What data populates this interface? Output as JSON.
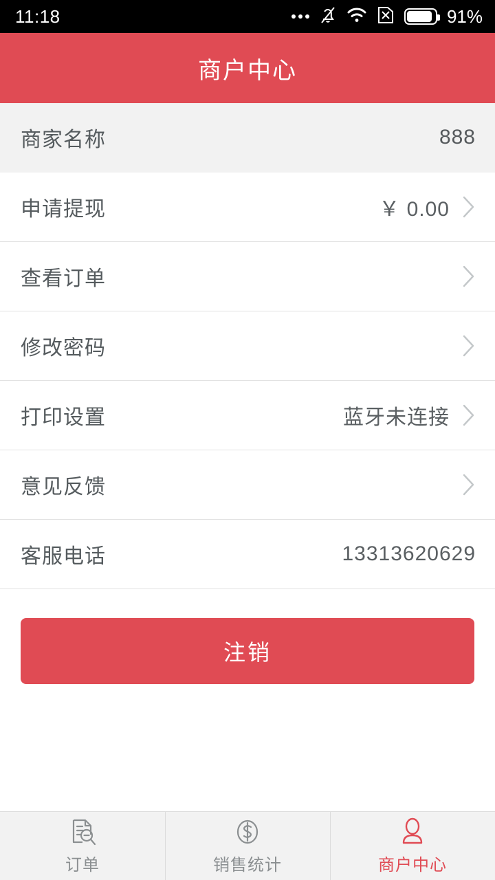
{
  "statusbar": {
    "time": "11:18",
    "battery_percent": "91%",
    "icons": [
      "more-dots-icon",
      "bell-muted-icon",
      "wifi-icon",
      "sim-disabled-icon",
      "battery-icon"
    ]
  },
  "header": {
    "title": "商户中心"
  },
  "list": {
    "rows": [
      {
        "label": "商家名称",
        "value": "888",
        "chevron": false,
        "shaded": true
      },
      {
        "label": "申请提现",
        "value": "￥ 0.00",
        "chevron": true,
        "shaded": false
      },
      {
        "label": "查看订单",
        "value": "",
        "chevron": true,
        "shaded": false
      },
      {
        "label": "修改密码",
        "value": "",
        "chevron": true,
        "shaded": false
      },
      {
        "label": "打印设置",
        "value": "蓝牙未连接",
        "chevron": true,
        "shaded": false
      },
      {
        "label": "意见反馈",
        "value": "",
        "chevron": true,
        "shaded": false
      },
      {
        "label": "客服电话",
        "value": "13313620629",
        "chevron": false,
        "shaded": false
      }
    ]
  },
  "logout": {
    "label": "注销"
  },
  "tabbar": {
    "tabs": [
      {
        "label": "订单",
        "icon": "order-document-search-icon",
        "active": false
      },
      {
        "label": "销售统计",
        "icon": "dollar-circle-icon",
        "active": false
      },
      {
        "label": "商户中心",
        "icon": "person-icon",
        "active": true
      }
    ]
  },
  "colors": {
    "accent": "#e04b54",
    "label_text": "#555b5e",
    "value_text": "#5a5f62",
    "inactive_tab": "#8b8f91",
    "row_divider": "#e2e2e2",
    "shaded_row_bg": "#f2f2f2",
    "tabbar_bg": "#f2f2f2"
  }
}
